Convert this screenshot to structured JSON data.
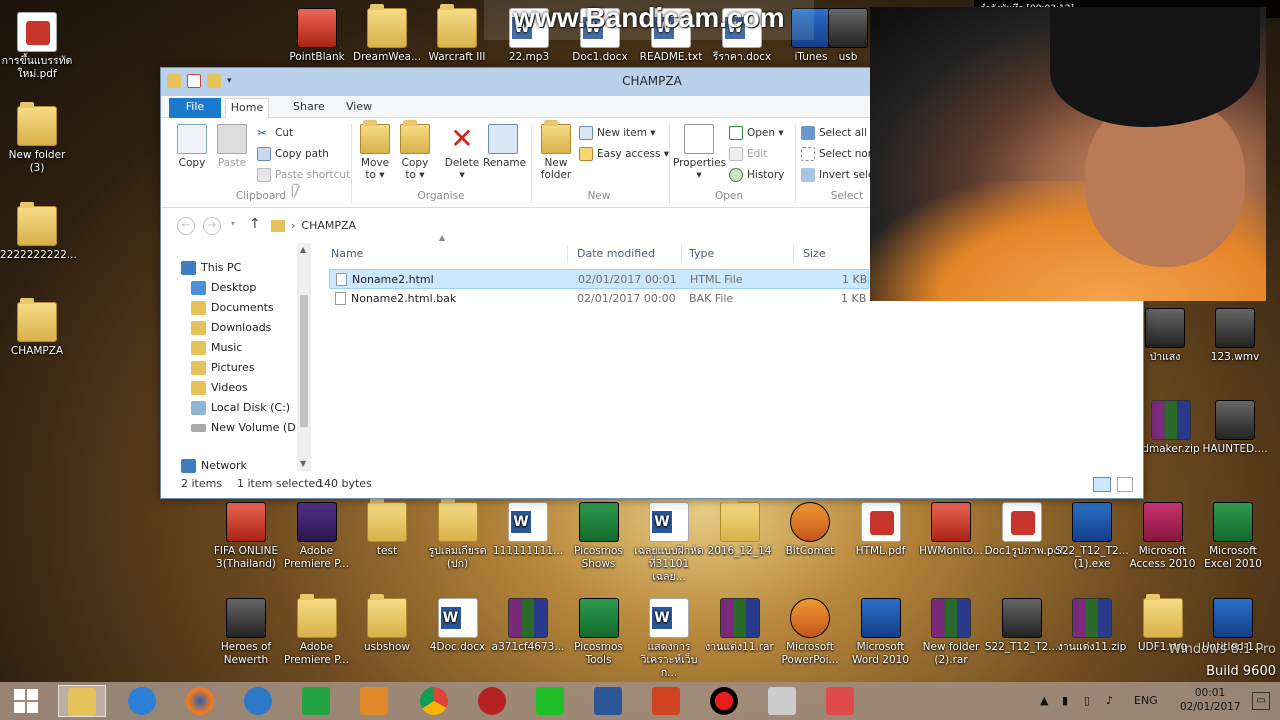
{
  "watermark": {
    "text": "www.Bandicam.com",
    "rec": "กำลังบันทึก [00:03:12]"
  },
  "desktop_left": [
    {
      "label": "การขึ้นแบรรทัดใหม่.pdf",
      "kind": "pdf"
    },
    {
      "label": "New folder (3)",
      "kind": "folder"
    },
    {
      "label": "2222222222...",
      "kind": "folder"
    },
    {
      "label": "CHAMPZA",
      "kind": "folder"
    }
  ],
  "desktop_top": [
    {
      "label": "PointBlank",
      "kind": "app red"
    },
    {
      "label": "DreamWea...",
      "kind": "folder"
    },
    {
      "label": "Warcraft III",
      "kind": "folder"
    },
    {
      "label": "22.mp3",
      "kind": "doc"
    },
    {
      "label": "Doc1.docx",
      "kind": "doc"
    },
    {
      "label": "README.txt",
      "kind": "doc"
    },
    {
      "label": "รีราคา.docx",
      "kind": "doc"
    },
    {
      "label": "iTunes",
      "kind": "app blue"
    },
    {
      "label": "usb",
      "kind": "app"
    }
  ],
  "desktop_row1": [
    {
      "label": "FIFA ONLINE 3(Thailand)",
      "kind": "app red"
    },
    {
      "label": "Adobe Premiere P...",
      "kind": "app purple"
    },
    {
      "label": "test",
      "kind": "folder"
    },
    {
      "label": "รูปเล่มเกียรต (ปก)",
      "kind": "folder"
    },
    {
      "label": "111111111...",
      "kind": "doc"
    },
    {
      "label": "Picosmos Shows",
      "kind": "app green"
    },
    {
      "label": "เฉลยแบบฝึกหัด ที่31101 เฉลย...",
      "kind": "doc"
    },
    {
      "label": "2016_12_14",
      "kind": "folder"
    },
    {
      "label": "BitComet",
      "kind": "app orange"
    },
    {
      "label": "HTML.pdf",
      "kind": "pdf"
    },
    {
      "label": "HWMonito...",
      "kind": "app red"
    },
    {
      "label": "Doc1รูปภาพ.pdf",
      "kind": "pdf"
    },
    {
      "label": "S22_T12_T2... (1).exe",
      "kind": "app blue"
    },
    {
      "label": "Microsoft Access 2010",
      "kind": "app pink"
    },
    {
      "label": "Microsoft Excel 2010",
      "kind": "app green"
    }
  ],
  "desktop_row2": [
    {
      "label": "Heroes of Newerth",
      "kind": "app"
    },
    {
      "label": "Adobe Premiere P...",
      "kind": "folder"
    },
    {
      "label": "usbshow",
      "kind": "folder"
    },
    {
      "label": "4Doc.docx",
      "kind": "doc"
    },
    {
      "label": "a371cf4673...",
      "kind": "rar"
    },
    {
      "label": "Picosmos Tools",
      "kind": "app green"
    },
    {
      "label": "แสดงการ วิเคราะห์เว็บ ก...",
      "kind": "doc"
    },
    {
      "label": "งานแต่ง11.rar",
      "kind": "rar"
    },
    {
      "label": "Microsoft PowerPoi...",
      "kind": "app orange"
    },
    {
      "label": "Microsoft Word 2010",
      "kind": "app blue"
    },
    {
      "label": "New folder (2).rar",
      "kind": "rar"
    },
    {
      "label": "S22_T12_T2...",
      "kind": "app"
    },
    {
      "label": "งานแต่ง11.zip",
      "kind": "rar"
    },
    {
      "label": "UDF1.nrg",
      "kind": "folder"
    },
    {
      "label": "Untitled-1...",
      "kind": "app blue"
    }
  ],
  "desktop_right": [
    {
      "label": "ป่าแสง",
      "kind": "app"
    },
    {
      "label": "123.wmv",
      "kind": "app"
    },
    {
      "label": "dmaker.zip",
      "kind": "rar"
    },
    {
      "label": "HAUNTED....",
      "kind": "app"
    }
  ],
  "explorer": {
    "title": "CHAMPZA",
    "tabs": {
      "file": "File",
      "home": "Home",
      "share": "Share",
      "view": "View"
    },
    "ribbon": {
      "copy": "Copy",
      "paste": "Paste",
      "cut": "Cut",
      "copy_path": "Copy path",
      "paste_shortcut": "Paste shortcut",
      "clipboard": "Clipboard",
      "move_to": "Move to ▾",
      "copy_to": "Copy to ▾",
      "delete": "Delete ▾",
      "rename": "Rename",
      "organise": "Organise",
      "new_folder": "New folder",
      "new_item": "New item ▾",
      "easy_access": "Easy access ▾",
      "new": "New",
      "properties": "Properties ▾",
      "open_btn": "Open ▾",
      "edit": "Edit",
      "history": "History",
      "open": "Open",
      "select_all": "Select all",
      "select_none": "Select none",
      "invert_selection": "Invert selec",
      "select": "Select"
    },
    "address": {
      "path": "CHAMPZA"
    },
    "nav": [
      "This PC",
      "Desktop",
      "Documents",
      "Downloads",
      "Music",
      "Pictures",
      "Videos",
      "Local Disk (C:)",
      "New Volume (D:",
      "Network"
    ],
    "columns": {
      "name": "Name",
      "date": "Date modified",
      "type": "Type",
      "size": "Size"
    },
    "files": [
      {
        "name": "Noname2.html",
        "date": "02/01/2017 00:01",
        "type": "HTML File",
        "size": "1 KB"
      },
      {
        "name": "Noname2.html.bak",
        "date": "02/01/2017 00:00",
        "type": "BAK File",
        "size": "1 KB"
      }
    ],
    "status": {
      "items": "2 items",
      "selected": "1 item selected",
      "bytes": "140 bytes"
    }
  },
  "taskbar": {
    "lang": "ENG",
    "time": "00:01",
    "date": "02/01/2017",
    "win_text": "Windows 8.1 Pro",
    "build": "Build 9600"
  }
}
